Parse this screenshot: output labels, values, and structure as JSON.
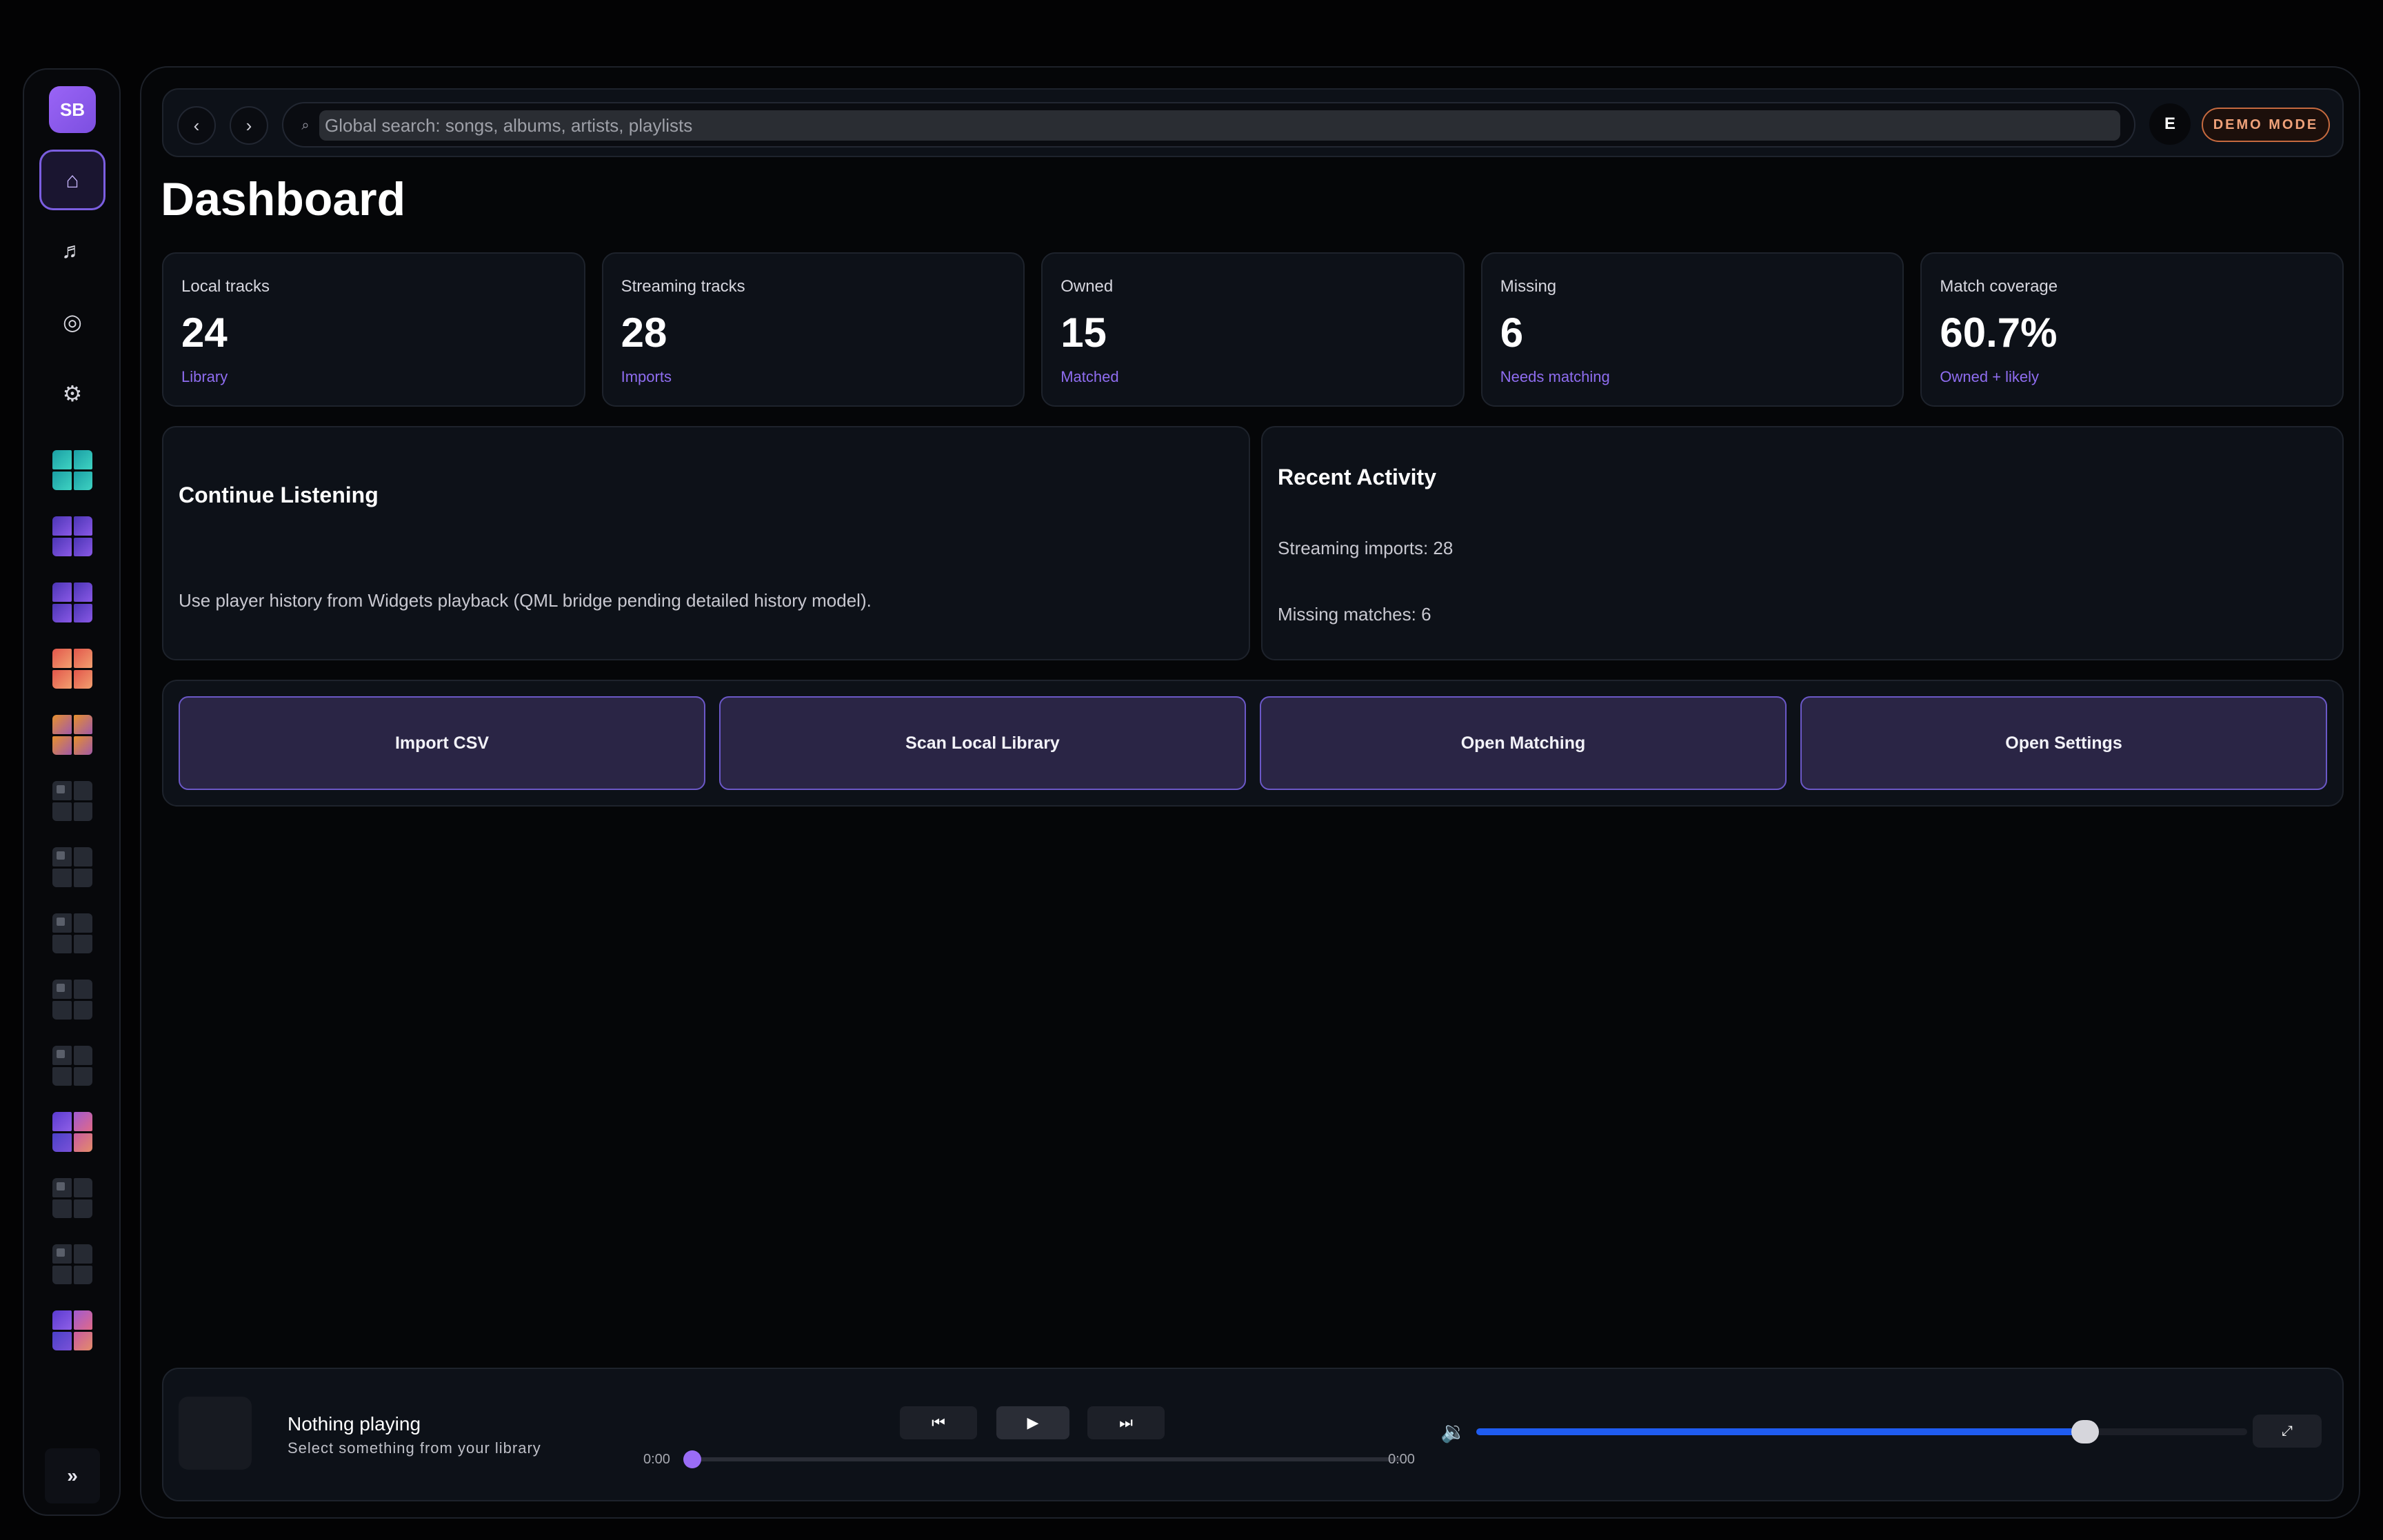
{
  "rail": {
    "avatar": "SB",
    "nav": [
      {
        "id": "home",
        "icon": "home-icon",
        "glyph": "⌂",
        "active": true
      },
      {
        "id": "music",
        "icon": "music-note-icon",
        "glyph": "♬",
        "active": false
      },
      {
        "id": "radio",
        "icon": "radio-icon",
        "glyph": "◎",
        "active": false
      },
      {
        "id": "settings",
        "icon": "gear-icon",
        "glyph": "⚙",
        "active": false
      }
    ],
    "playlist_thumbs": [
      "teal",
      "violet",
      "violet",
      "coral",
      "amber",
      "blank",
      "blank",
      "blank",
      "blank",
      "blank",
      "mixed",
      "blank",
      "blank",
      "mixed"
    ],
    "expand_glyph": "»"
  },
  "topbar": {
    "back_glyph": "‹",
    "forward_glyph": "›",
    "search_glyph": "⌕",
    "search_placeholder": "Global search: songs, albums, artists, playlists",
    "user_initial": "E",
    "demo_badge": "DEMO MODE"
  },
  "page": {
    "title": "Dashboard"
  },
  "stats": [
    {
      "label": "Local tracks",
      "value": "24",
      "sub": "Library"
    },
    {
      "label": "Streaming tracks",
      "value": "28",
      "sub": "Imports"
    },
    {
      "label": "Owned",
      "value": "15",
      "sub": "Matched"
    },
    {
      "label": "Missing",
      "value": "6",
      "sub": "Needs matching"
    },
    {
      "label": "Match coverage",
      "value": "60.7%",
      "sub": "Owned + likely"
    }
  ],
  "continue_listening": {
    "title": "Continue Listening",
    "text": "Use player history from Widgets playback (QML bridge pending detailed history model)."
  },
  "recent_activity": {
    "title": "Recent Activity",
    "lines": [
      "Streaming imports: 28",
      "Missing matches: 6"
    ]
  },
  "actions": [
    "Import CSV",
    "Scan Local Library",
    "Open Matching",
    "Open Settings"
  ],
  "player": {
    "title": "Nothing playing",
    "subtitle": "Select something from your library",
    "prev_glyph": "⏮",
    "play_glyph": "▶",
    "next_glyph": "⏭",
    "elapsed": "0:00",
    "duration": "0:00",
    "progress": 0,
    "volume_icon": "🔉",
    "volume": 0.79,
    "fullscreen_glyph": "⤢",
    "colors": {
      "accent": "#9a6cf5",
      "volume": "#1f5cf0"
    }
  }
}
